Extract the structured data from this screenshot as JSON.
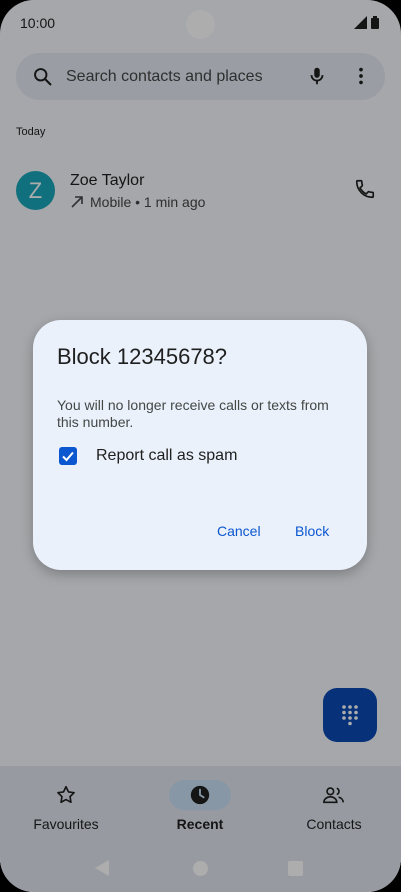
{
  "status_bar": {
    "time": "10:00"
  },
  "search": {
    "placeholder": "Search contacts and places"
  },
  "list": {
    "section_header": "Today",
    "calls": [
      {
        "avatar_letter": "Z",
        "name": "Zoe Taylor",
        "meta": "Mobile • 1 min ago",
        "direction": "outgoing"
      }
    ]
  },
  "dialog": {
    "title": "Block 12345678?",
    "body": "You will no longer receive calls or texts from this number.",
    "checkbox_label": "Report call as spam",
    "checkbox_checked": true,
    "cancel_label": "Cancel",
    "confirm_label": "Block"
  },
  "bottom_nav": {
    "items": [
      {
        "label": "Favourites",
        "icon": "star-icon",
        "active": false
      },
      {
        "label": "Recent",
        "icon": "clock-icon",
        "active": true
      },
      {
        "label": "Contacts",
        "icon": "contacts-icon",
        "active": false
      }
    ]
  },
  "colors": {
    "accent": "#0b57d0",
    "fab": "#0b4bb3",
    "avatar": "#1aa5b8",
    "active_nav_pill": "#c7dff5"
  }
}
